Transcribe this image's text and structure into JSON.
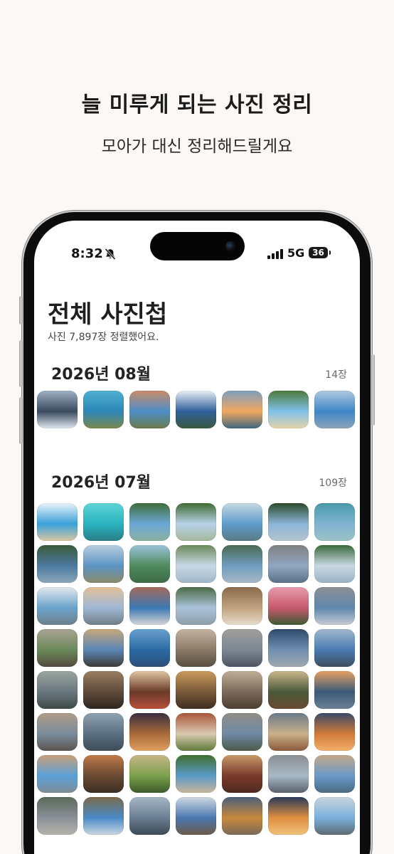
{
  "promo": {
    "headline": "늘 미루게 되는 사진 정리",
    "subline": "모아가 대신 정리해드릴게요"
  },
  "status_bar": {
    "time": "8:32",
    "network": "5G",
    "battery": "36",
    "icons": [
      "bell-slash-icon",
      "signal-bars-icon",
      "battery-icon"
    ]
  },
  "album": {
    "title": "전체 사진첩",
    "subtitle": "사진 7,897장 정렬했어요."
  },
  "sections": [
    {
      "title": "2026년 08월",
      "count": "14장",
      "photos": [
        [
          "#3a4a5e",
          "#9fb1c4",
          "#dfe6ee"
        ],
        [
          "#2d86b8",
          "#4fb1cf",
          "#7a8a4e"
        ],
        [
          "#4d8fc8",
          "#c98a6a",
          "#6a7a4a"
        ],
        [
          "#2f5f9a",
          "#e8eef5",
          "#3b5a3e"
        ],
        [
          "#f0a860",
          "#7e9fbf",
          "#3e6680"
        ],
        [
          "#7fc2ea",
          "#4b7a3a",
          "#e6d3a8"
        ],
        [
          "#3e86c8",
          "#b0c9df",
          "#8fa3b7"
        ]
      ]
    },
    {
      "title": "2026년 07월",
      "count": "109장",
      "photos": [
        [
          "#3aa0da",
          "#e8f2f8",
          "#d9c7a2"
        ],
        [
          "#28b3c0",
          "#5fd3d6",
          "#2b7e86"
        ],
        [
          "#6aa8d6",
          "#3f6d3a",
          "#8bb0a0"
        ],
        [
          "#b7d3e8",
          "#3f6b32",
          "#a4b79a"
        ],
        [
          "#5d9ccc",
          "#c7d8e3",
          "#5a7a84"
        ],
        [
          "#8ab6d8",
          "#2e4a2a",
          "#b4c4cf"
        ],
        [
          "#7fb3d0",
          "#4a9aa8",
          "#9dc2c7"
        ],
        [
          "#4c7aa0",
          "#3b5a3a",
          "#8aa7b8"
        ],
        [
          "#5b93c2",
          "#b9cfe0",
          "#8a8a6a"
        ],
        [
          "#4f8a5c",
          "#9ac3d9",
          "#3d6b47"
        ],
        [
          "#c8d9e6",
          "#6a8a5a",
          "#9fb6c8"
        ],
        [
          "#6f9dbf",
          "#4a6a52",
          "#a7b8c4"
        ],
        [
          "#8fa8c2",
          "#7f7f7f",
          "#5a7088"
        ],
        [
          "#c9d8e3",
          "#3a6a3a",
          "#9ab3c5"
        ],
        [
          "#6aa3cc",
          "#e1e8ee",
          "#6e7f8a"
        ],
        [
          "#9eb8d4",
          "#e3c09a",
          "#6f7d86"
        ],
        [
          "#3b78b3",
          "#a56a5a",
          "#d5d5d5"
        ],
        [
          "#aac3d9",
          "#4b6b45",
          "#8e9ea8"
        ],
        [
          "#c0a27e",
          "#8a6a4a",
          "#e6dccc"
        ],
        [
          "#c75a6e",
          "#e79bab",
          "#3f5a32"
        ],
        [
          "#5f87ad",
          "#8c8f93",
          "#c5ccd2"
        ],
        [
          "#6b8a5a",
          "#a9a293",
          "#52493e"
        ],
        [
          "#5a86b5",
          "#c6a77c",
          "#3d3a36"
        ],
        [
          "#2a6aa5",
          "#6aa0cf",
          "#2c4f78"
        ],
        [
          "#8a7a66",
          "#c4b3a0",
          "#5a4e42"
        ],
        [
          "#7b8894",
          "#a29f9a",
          "#4e5560"
        ],
        [
          "#6f8fb0",
          "#2f4a6b",
          "#a0a7ae"
        ],
        [
          "#4b7bb2",
          "#9fb7cd",
          "#3d4e5e"
        ],
        [
          "#6a7780",
          "#9aa5a0",
          "#3e4a44"
        ],
        [
          "#5f4a3a",
          "#9a7f62",
          "#2e2620"
        ],
        [
          "#6a3a28",
          "#e1c6a0",
          "#b8503a"
        ],
        [
          "#7a5a3a",
          "#c99a5a",
          "#3e2e20"
        ],
        [
          "#7b6a5a",
          "#bfae95",
          "#4b3e30"
        ],
        [
          "#4a5a3a",
          "#c9b58a",
          "#6a4a30"
        ],
        [
          "#3a5a7a",
          "#e8a060",
          "#6b7f93"
        ],
        [
          "#7a8c9c",
          "#b09c86",
          "#5b5550"
        ],
        [
          "#5a6f82",
          "#8fa2b0",
          "#3e4d58"
        ],
        [
          "#a86a3a",
          "#3a3040",
          "#e0a060"
        ],
        [
          "#d9c9b0",
          "#a8563a",
          "#5f7a3a"
        ],
        [
          "#6f8aa6",
          "#8e8e84",
          "#4a5a4a"
        ],
        [
          "#c9b08a",
          "#6a7a8a",
          "#8a5a3a"
        ],
        [
          "#d07a3a",
          "#3a4a6a",
          "#f2b06a"
        ],
        [
          "#5aa0d8",
          "#c9a07a",
          "#7e8e96"
        ],
        [
          "#6a4a32",
          "#c07a4a",
          "#3a2e22"
        ],
        [
          "#7aa04a",
          "#c8b68a",
          "#3e5a2a"
        ],
        [
          "#5a9ac8",
          "#3f6e2e",
          "#c8b69a"
        ],
        [
          "#7a3a2a",
          "#c89a6a",
          "#4e2a20"
        ],
        [
          "#a7b8c8",
          "#8a8f92",
          "#5a606a"
        ],
        [
          "#6a9ac8",
          "#c4a88a",
          "#4a6a82"
        ],
        [
          "#8a9098",
          "#5a6a5a",
          "#b7b2aa"
        ],
        [
          "#4a8ac8",
          "#7a6a4a",
          "#c9d6e0"
        ],
        [
          "#6a7f94",
          "#a6b6c4",
          "#3e4a56"
        ],
        [
          "#4a78b0",
          "#cfd9e2",
          "#6a5a4a"
        ],
        [
          "#c8883e",
          "#4a5f7a",
          "#7a6a58"
        ],
        [
          "#e09040",
          "#2a3a5a",
          "#f0c07a"
        ],
        [
          "#7ab0dc",
          "#c8d4dc",
          "#5a6a70"
        ]
      ]
    }
  ]
}
